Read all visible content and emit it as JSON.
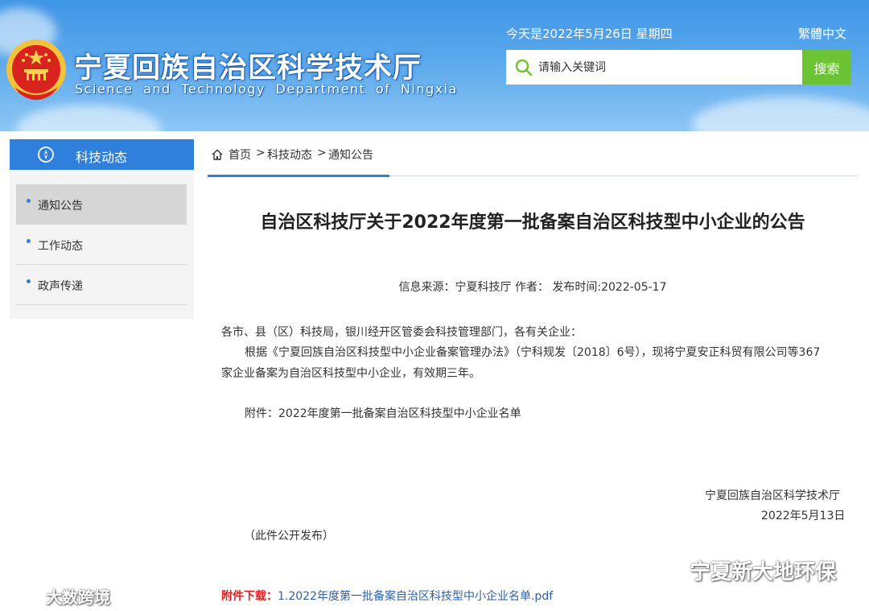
{
  "header": {
    "site_title": "宁夏回族自治区科学技术厅",
    "site_subtitle": "Science and Technology Department of Ningxia",
    "date_text": "今天是2022年5月26日 星期四",
    "lang_link": "繁體中文",
    "search_placeholder": "请输入关键词",
    "search_button": "搜索",
    "emblem_icon": "national-emblem-icon",
    "colors": {
      "header_blue": "#3f95e6",
      "search_green": "#6cc434"
    }
  },
  "sidebar": {
    "title": "科技动态",
    "items": [
      {
        "label": "通知公告",
        "active": true
      },
      {
        "label": "工作动态",
        "active": false
      },
      {
        "label": "政声传递",
        "active": false
      }
    ],
    "colors": {
      "header_blue": "#2f7fdc"
    }
  },
  "breadcrumb": {
    "home": "首页",
    "items": [
      "科技动态",
      "通知公告"
    ],
    "separator": ">"
  },
  "article": {
    "title": "自治区科技厅关于2022年度第一批备案自治区科技型中小企业的公告",
    "meta": "信息来源：宁夏科技厅  作者：   发布时间:2022-05-17",
    "salutation": "各市、县（区）科技局，银川经开区管委会科技管理部门，各有关企业：",
    "body_line1": "根据《宁夏回族自治区科技型中小企业备案管理办法》（宁科规发〔2018〕6号），现将宁夏安正科贸有限公司等367",
    "body_line2": "家企业备案为自治区科技型中小企业，有效期三年。",
    "attachment": "附件：2022年度第一批备案自治区科技型中小企业名单",
    "signature_org": "宁夏回族自治区科学技术厅",
    "signature_date": "2022年5月13日",
    "public_note": "（此件公开发布）",
    "download_label": "附件下载：",
    "download_link": "1.2022年度第一批备案自治区科技型中小企业名单.pdf"
  },
  "watermarks": {
    "right": "宁夏新大地环保",
    "left": "大数跨境"
  }
}
